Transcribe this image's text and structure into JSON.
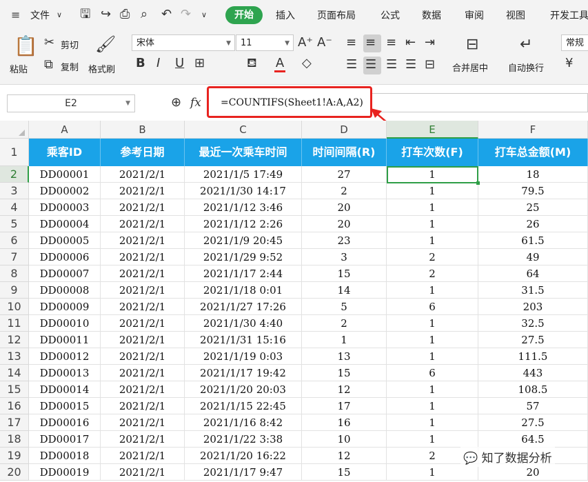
{
  "menubar": {
    "file": "文件",
    "tabs": [
      "开始",
      "插入",
      "页面布局",
      "公式",
      "数据",
      "审阅",
      "视图",
      "开发工具"
    ],
    "active_tab": "开始"
  },
  "ribbon": {
    "paste": "粘贴",
    "cut": "剪切",
    "copy": "复制",
    "format_painter": "格式刷",
    "font_name": "宋体",
    "font_size": "11",
    "merge_center": "合并居中",
    "wrap_text": "自动换行",
    "number_format": "常规"
  },
  "formula_bar": {
    "name_box": "E2",
    "fx": "fx",
    "formula": "=COUNTIFS(Sheet1!A:A,A2)"
  },
  "columns": [
    "A",
    "B",
    "C",
    "D",
    "E",
    "F"
  ],
  "header_row_number": "1",
  "headers": [
    "乘客ID",
    "参考日期",
    "最近一次乘车时间",
    "时间间隔(R)",
    "打车次数(F)",
    "打车总金额(M)"
  ],
  "rows": [
    {
      "n": "2",
      "cells": [
        "DD00001",
        "2021/2/1",
        "2021/1/5 17:49",
        "27",
        "1",
        "18"
      ]
    },
    {
      "n": "3",
      "cells": [
        "DD00002",
        "2021/2/1",
        "2021/1/30 14:17",
        "2",
        "1",
        "79.5"
      ]
    },
    {
      "n": "4",
      "cells": [
        "DD00003",
        "2021/2/1",
        "2021/1/12 3:46",
        "20",
        "1",
        "25"
      ]
    },
    {
      "n": "5",
      "cells": [
        "DD00004",
        "2021/2/1",
        "2021/1/12 2:26",
        "20",
        "1",
        "26"
      ]
    },
    {
      "n": "6",
      "cells": [
        "DD00005",
        "2021/2/1",
        "2021/1/9 20:45",
        "23",
        "1",
        "61.5"
      ]
    },
    {
      "n": "7",
      "cells": [
        "DD00006",
        "2021/2/1",
        "2021/1/29 9:52",
        "3",
        "2",
        "49"
      ]
    },
    {
      "n": "8",
      "cells": [
        "DD00007",
        "2021/2/1",
        "2021/1/17 2:44",
        "15",
        "2",
        "64"
      ]
    },
    {
      "n": "9",
      "cells": [
        "DD00008",
        "2021/2/1",
        "2021/1/18 0:01",
        "14",
        "1",
        "31.5"
      ]
    },
    {
      "n": "10",
      "cells": [
        "DD00009",
        "2021/2/1",
        "2021/1/27 17:26",
        "5",
        "6",
        "203"
      ]
    },
    {
      "n": "11",
      "cells": [
        "DD00010",
        "2021/2/1",
        "2021/1/30 4:40",
        "2",
        "1",
        "32.5"
      ]
    },
    {
      "n": "12",
      "cells": [
        "DD00011",
        "2021/2/1",
        "2021/1/31 15:16",
        "1",
        "1",
        "27.5"
      ]
    },
    {
      "n": "13",
      "cells": [
        "DD00012",
        "2021/2/1",
        "2021/1/19 0:03",
        "13",
        "1",
        "111.5"
      ]
    },
    {
      "n": "14",
      "cells": [
        "DD00013",
        "2021/2/1",
        "2021/1/17 19:42",
        "15",
        "6",
        "443"
      ]
    },
    {
      "n": "15",
      "cells": [
        "DD00014",
        "2021/2/1",
        "2021/1/20 20:03",
        "12",
        "1",
        "108.5"
      ]
    },
    {
      "n": "16",
      "cells": [
        "DD00015",
        "2021/2/1",
        "2021/1/15 22:45",
        "17",
        "1",
        "57"
      ]
    },
    {
      "n": "17",
      "cells": [
        "DD00016",
        "2021/2/1",
        "2021/1/16 8:42",
        "16",
        "1",
        "27.5"
      ]
    },
    {
      "n": "18",
      "cells": [
        "DD00017",
        "2021/2/1",
        "2021/1/22 3:38",
        "10",
        "1",
        "64.5"
      ]
    },
    {
      "n": "19",
      "cells": [
        "DD00018",
        "2021/2/1",
        "2021/1/20 16:22",
        "12",
        "2",
        ""
      ]
    },
    {
      "n": "20",
      "cells": [
        "DD00019",
        "2021/2/1",
        "2021/1/17 9:47",
        "15",
        "1",
        "20"
      ]
    }
  ],
  "watermark": "知了数据分析",
  "colors": {
    "header_bg": "#1aa3e8",
    "accent_green": "#2e9e46",
    "highlight_red": "#e8231f"
  }
}
